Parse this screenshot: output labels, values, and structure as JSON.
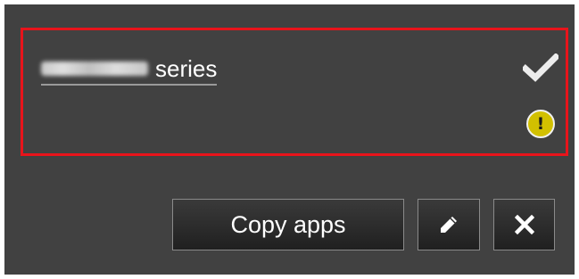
{
  "printer": {
    "name_suffix": "series",
    "icons": {
      "status_ok": "checkmark-icon",
      "status_warning": "warning-icon",
      "warning_symbol": "!"
    }
  },
  "toolbar": {
    "copy_label": "Copy apps",
    "edit_icon": "pencil-icon",
    "delete_icon": "close-icon"
  },
  "colors": {
    "panel_background": "#414141",
    "selection_border": "#e8141b",
    "warning": "#d2c000"
  }
}
